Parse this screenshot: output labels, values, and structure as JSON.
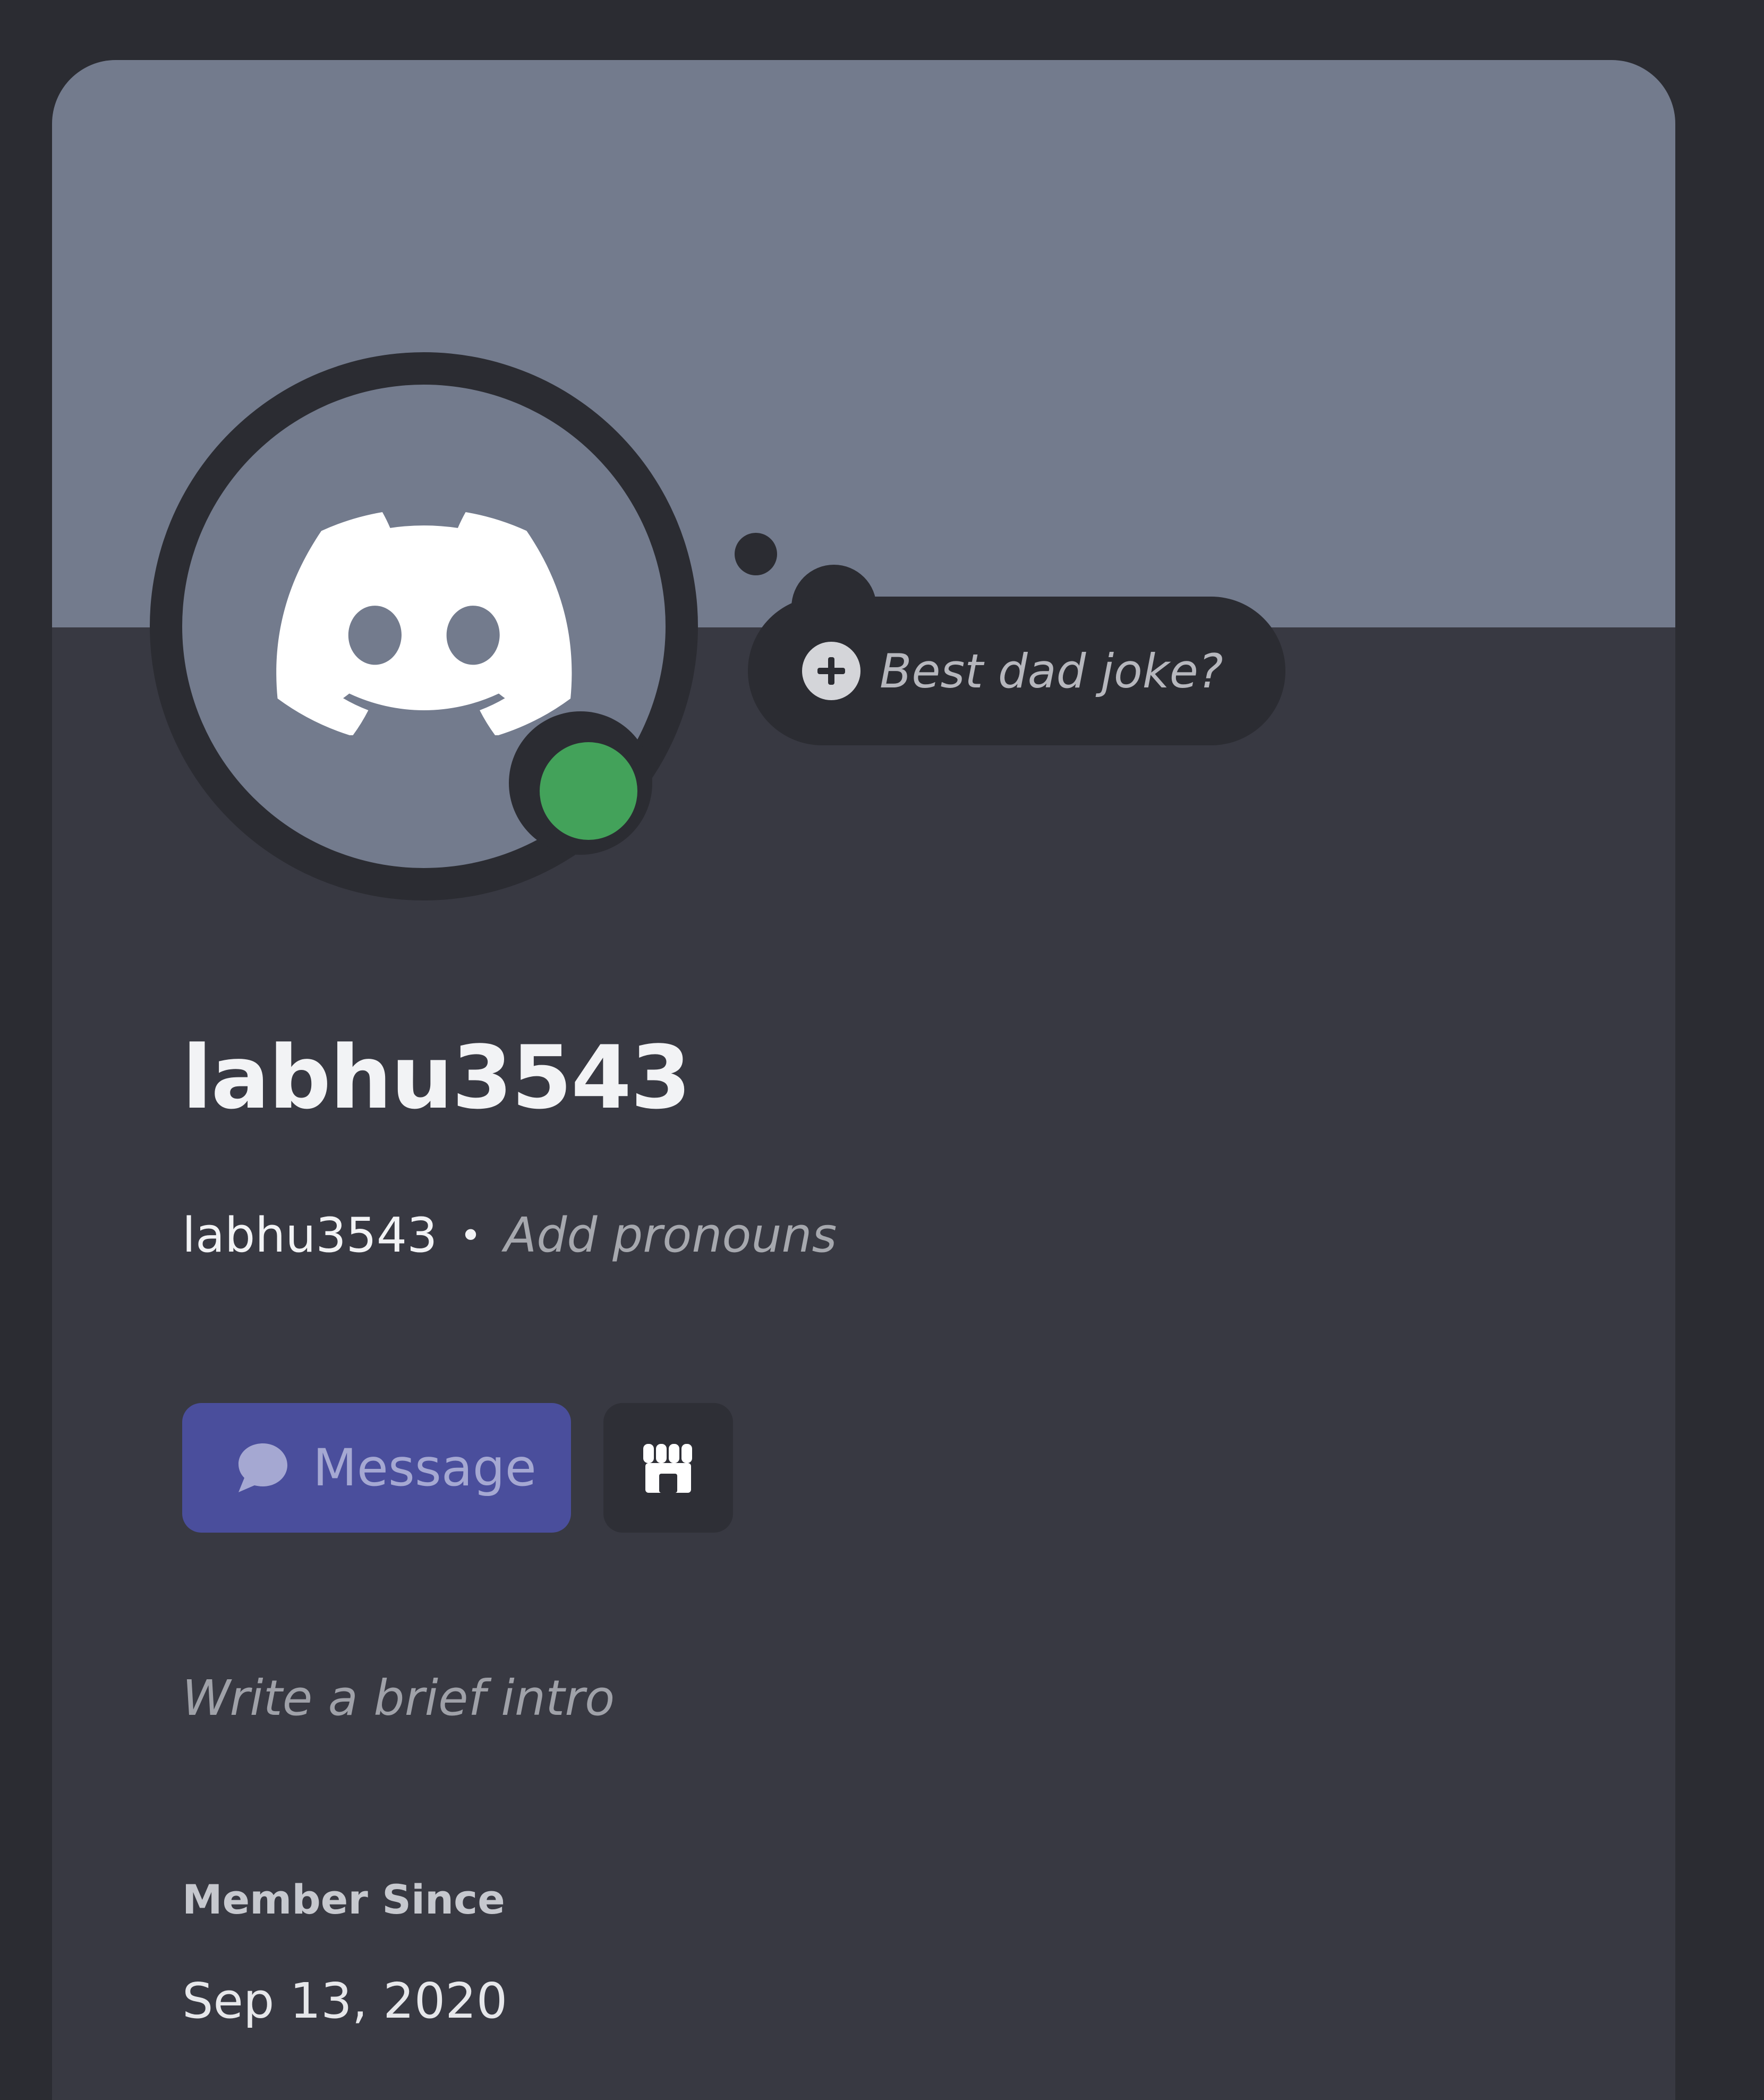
{
  "profile": {
    "display_name": "labhu3543",
    "username": "labhu3543",
    "separator": "•",
    "pronouns_placeholder": "Add pronouns",
    "status": "online",
    "avatar_icon": "discord-logo-icon"
  },
  "status_bubble": {
    "icon": "plus-icon",
    "prompt": "Best dad joke?"
  },
  "actions": {
    "message_label": "Message",
    "message_icon": "chat-bubble-icon",
    "shop_icon": "shop-icon"
  },
  "bio": {
    "placeholder": "Write a brief intro"
  },
  "member_since": {
    "label": "Member Since",
    "date": "Sep 13, 2020"
  },
  "colors": {
    "background": "#2b2c32",
    "card": "#383942",
    "banner": "#737b8d",
    "online": "#43a25a",
    "message_button": "#4a4e9c"
  }
}
